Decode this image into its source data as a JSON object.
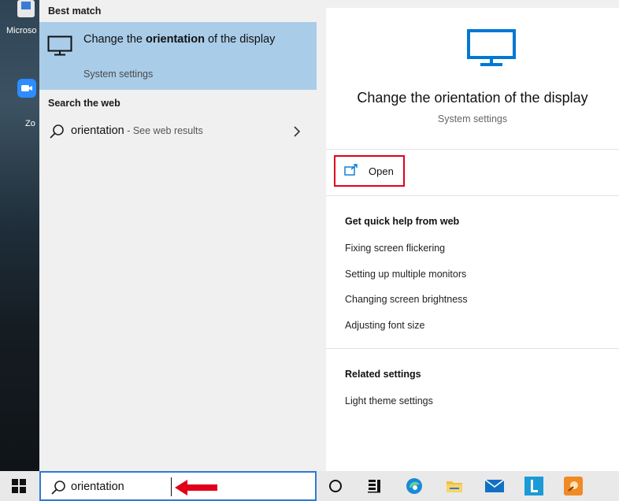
{
  "desktop": {
    "icons": [
      {
        "label": "Microso",
        "color": "#3a7bd5"
      },
      {
        "label": "Zo",
        "color": "#2d8cff"
      }
    ]
  },
  "results": {
    "best_match_header": "Best match",
    "best_match": {
      "title_before": "Change the ",
      "title_bold": "orientation",
      "title_after": " of the display",
      "subtitle": "System settings",
      "icon": "monitor-icon"
    },
    "web_header": "Search the web",
    "web_result": {
      "query": "orientation",
      "hint": " - See web results",
      "icon": "search-icon"
    }
  },
  "preview": {
    "title": "Change the orientation of the display",
    "subtitle": "System settings",
    "open_label": "Open",
    "quick_help_header": "Get quick help from web",
    "quick_help_links": [
      "Fixing screen flickering",
      "Setting up multiple monitors",
      "Changing screen brightness",
      "Adjusting font size"
    ],
    "related_header": "Related settings",
    "related_links": [
      "Light theme settings"
    ]
  },
  "taskbar": {
    "search_value": "orientation",
    "icons": [
      "windows-start-icon",
      "cortana-icon",
      "task-view-icon",
      "edge-icon",
      "file-explorer-icon",
      "mail-icon",
      "l-app-icon",
      "orange-app-icon"
    ]
  },
  "colors": {
    "accent": "#0078d4",
    "highlight": "#a9cce8",
    "callout_red": "#e0001a"
  }
}
